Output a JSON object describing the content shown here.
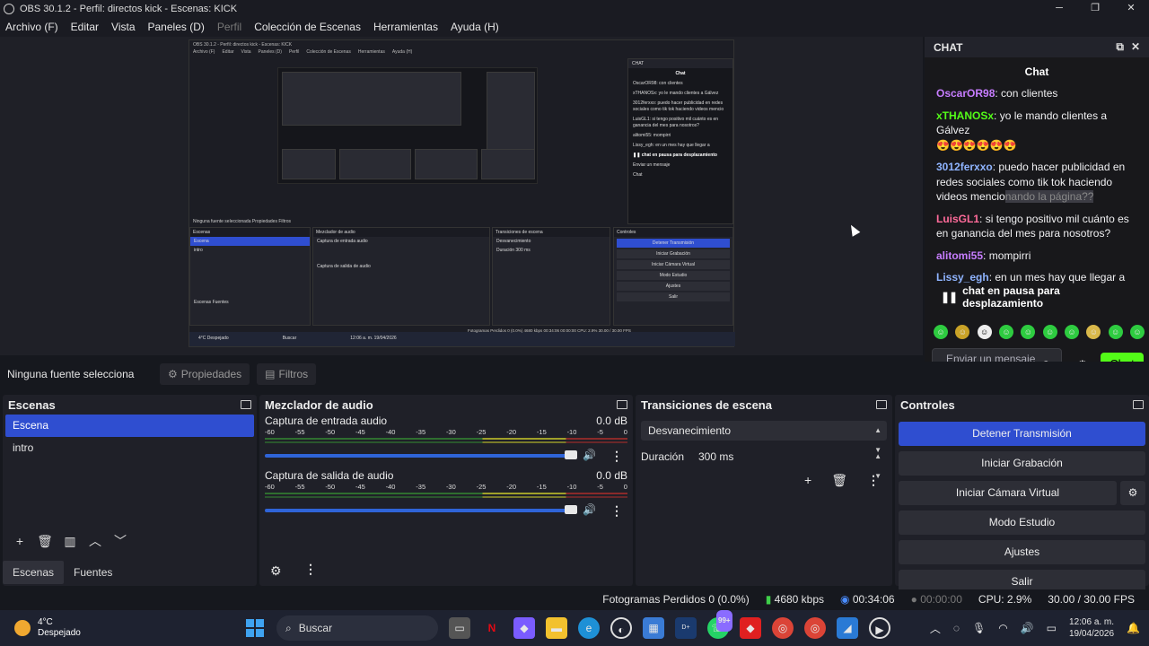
{
  "window": {
    "title": "OBS 30.1.2 - Perfil: directos kick - Escenas: KICK",
    "min": "─",
    "max": "❐",
    "close": "✕"
  },
  "menu": [
    "Archivo (F)",
    "Editar",
    "Vista",
    "Paneles (D)",
    "Perfil",
    "Colección de Escenas",
    "Herramientas",
    "Ayuda (H)"
  ],
  "nested": {
    "title": "OBS 30.1.2 - Perfil: directos kick - Escenas: KICK",
    "menu": [
      "Archivo (F)",
      "Editar",
      "Vista",
      "Paneles (D)",
      "Perfil",
      "Colección de Escenas",
      "Herramientas",
      "Ayuda (H)"
    ],
    "chat_head": "CHAT",
    "chat_title": "Chat",
    "msgs": [
      "OscarOR98: con clientes",
      "xTHANOSx: yo le mando clientes a Gálvez",
      "3012ferxxo: puedo hacer publicidad en redes sociales como tik tok haciendo videos mencio",
      "LuisGL1: si tengo positivo mil cuánto es en ganancia del mes para nosotros?",
      "alitomi55: mompirri",
      "Lissy_egh: en un mes hay que llegar a"
    ],
    "pause": "❚❚ chat en pausa para desplazamiento",
    "input": "Enviar un mensaje",
    "send": "Chat",
    "no_source": "Ninguna fuente seleccionada",
    "props": "Propiedades",
    "filters": "Filtros",
    "scenes": "Escenas",
    "scene1": "Escena",
    "scene2": "intro",
    "mixer": "Mezclador de audio",
    "mic": "Captura de entrada audio",
    "desk": "Captura de salida de audio",
    "trans": "Transiciones de escena",
    "fade": "Desvanecimiento",
    "dur": "Duración",
    "dur_v": "300 ms",
    "controls": "Controles",
    "ctrl": [
      "Detener Transmisión",
      "Iniciar Grabación",
      "Iniciar Cámara Virtual",
      "Modo Estudio",
      "Ajustes",
      "Salir"
    ],
    "tab1": "Escenas",
    "tab2": "Fuentes",
    "status": "Fotogramas Perdidos 0 (0.0%)   4680 kbps   00:34:06   00:00:00   CPU: 2.9%   30.00 / 30.00 FPS",
    "weather": "4°C Despejado",
    "search": "Buscar",
    "clock": "12:06 a. m. 19/04/2026"
  },
  "chat": {
    "dock_title": "CHAT",
    "header": "Chat",
    "messages": [
      {
        "user": "OscarOR98",
        "color": "#c77dff",
        "text": "con clientes"
      },
      {
        "user": "xTHANOSx",
        "color": "#53fc18",
        "text": "yo le mando clientes a Gálvez",
        "emoji": "😍😍😍😍😍😍"
      },
      {
        "user": "3012ferxxo",
        "color": "#8fb4ff",
        "text": "puedo hacer publicidad en redes sociales como tik tok haciendo videos mencio",
        "hidden": "nando la página??"
      },
      {
        "user": "LuisGL1",
        "color": "#ff6b9a",
        "text": "si tengo positivo mil cuánto es en ganancia del mes para nosotros?"
      },
      {
        "user": "alitomi55",
        "color": "#c77dff",
        "text": "mompirri"
      },
      {
        "user": "Lissy_egh",
        "color": "#8fb4ff",
        "text": "en un mes hay que llegar a"
      }
    ],
    "pause_text": "chat en pausa para desplazamiento",
    "input_placeholder": "Enviar un mensaje",
    "send_label": "Chat"
  },
  "toolbar": {
    "no_source": "Ninguna fuente selecciona",
    "properties": "Propiedades",
    "filters": "Filtros"
  },
  "scenes": {
    "title": "Escenas",
    "items": [
      "Escena",
      "intro"
    ],
    "tabs": [
      "Escenas",
      "Fuentes"
    ]
  },
  "mixer": {
    "title": "Mezclador de audio",
    "channels": [
      {
        "name": "Captura de entrada audio",
        "db": "0.0 dB",
        "volume": 0.97
      },
      {
        "name": "Captura de salida de audio",
        "db": "0.0 dB",
        "volume": 0.97
      }
    ],
    "scale": [
      "-60",
      "-55",
      "-50",
      "-45",
      "-40",
      "-35",
      "-30",
      "-25",
      "-20",
      "-15",
      "-10",
      "-5",
      "0"
    ]
  },
  "transitions": {
    "title": "Transiciones de escena",
    "selected": "Desvanecimiento",
    "duration_label": "Duración",
    "duration_value": "300 ms"
  },
  "controls": {
    "title": "Controles",
    "buttons": [
      "Detener Transmisión",
      "Iniciar Grabación",
      "Iniciar Cámara Virtual",
      "Modo Estudio",
      "Ajustes",
      "Salir"
    ]
  },
  "status": {
    "dropped": "Fotogramas Perdidos 0 (0.0%)",
    "bitrate": "4680 kbps",
    "stream_time": "00:34:06",
    "rec_time": "00:00:00",
    "cpu": "CPU: 2.9%",
    "fps": "30.00 / 30.00 FPS"
  },
  "taskbar": {
    "temp": "4°C",
    "weather": "Despejado",
    "search": "Buscar",
    "time": "12:06 a. m.",
    "date": "19/04/2026",
    "badge": "99+"
  },
  "colors": {
    "accent": "#2f4ed0",
    "kick": "#53fc18",
    "bg": "#16181e",
    "dock": "#1f2028"
  }
}
